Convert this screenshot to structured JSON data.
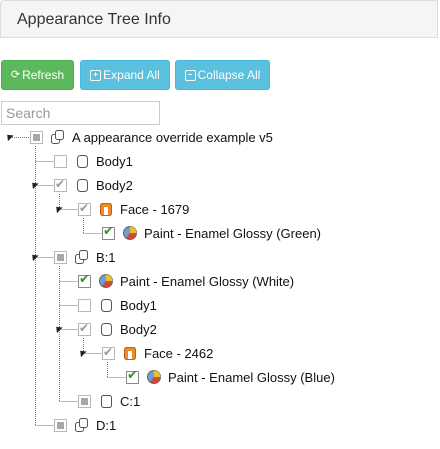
{
  "header": {
    "title": "Appearance Tree Info"
  },
  "toolbar": {
    "refresh_label": "Refresh",
    "expand_label": "Expand All",
    "collapse_label": "Collapse All"
  },
  "search": {
    "placeholder": "Search",
    "value": ""
  },
  "tree": {
    "root": "A appearance override example v5",
    "body1": "Body1",
    "body2": "Body2",
    "face1679": "Face - 1679",
    "paint_green": "Paint - Enamel Glossy (Green)",
    "b1": "B:1",
    "paint_white": "Paint - Enamel Glossy (White)",
    "b_body1": "Body1",
    "b_body2": "Body2",
    "face2462": "Face - 2462",
    "paint_blue": "Paint - Enamel Glossy (Blue)",
    "c1": "C:1",
    "d1": "D:1"
  },
  "colors": {
    "refresh": "#5cb85c",
    "info": "#5bc0de",
    "check": "#2a9a25",
    "face": "#f08a24"
  }
}
